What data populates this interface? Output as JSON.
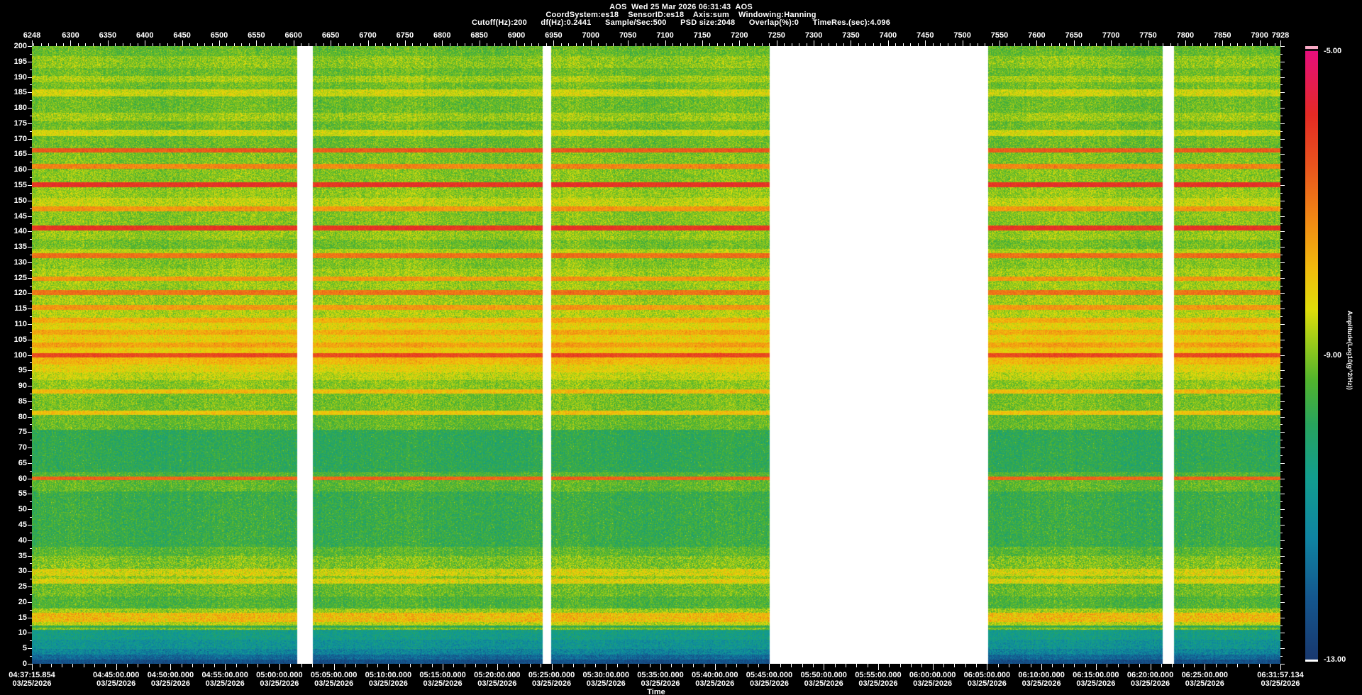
{
  "window": {
    "background": "#000000",
    "text_color": "#ffffff"
  },
  "header": {
    "title_line": "AOS  Wed 25 Mar 2026 06:31:43  AOS",
    "params_line1": "CoordSystem:es18    SensorID:es18    Axis:sum    Windowing:Hanning",
    "params_line2": "Cutoff(Hz):200      df(Hz):0.2441      Sample/Sec:500      PSD size:2048      Overlap(%):0      TimeRes.(sec):4.096"
  },
  "chart_data": {
    "type": "heatmap",
    "subtype": "spectrogram",
    "title": "AOS  Wed 25 Mar 2026 06:31:43  AOS",
    "acquisition": {
      "coord_system": "es18",
      "sensor_id": "es18",
      "axis": "sum",
      "windowing": "Hanning",
      "cutoff_hz": 200,
      "df_hz": 0.2441,
      "sample_per_sec": 500,
      "psd_size": 2048,
      "overlap_pct": 0,
      "time_res_sec": 4.096
    },
    "record_axis": {
      "position": "top",
      "range": [
        6248,
        7928
      ],
      "minor_step": 10,
      "ticks": [
        6248,
        6300,
        6350,
        6400,
        6450,
        6500,
        6550,
        6600,
        6650,
        6700,
        6750,
        6800,
        6850,
        6900,
        6950,
        7000,
        7050,
        7100,
        7150,
        7200,
        7250,
        7300,
        7350,
        7400,
        7450,
        7500,
        7550,
        7600,
        7650,
        7700,
        7750,
        7800,
        7850,
        7900,
        7928
      ]
    },
    "time_axis": {
      "position": "bottom",
      "title": "Time",
      "date": "03/25/2026",
      "start": "04:37:15.854",
      "end": "06:31:57.134",
      "minor_step_sec": 60,
      "ticks": [
        "04:37:15.854",
        "04:45:00.000",
        "04:50:00.000",
        "04:55:00.000",
        "05:00:00.000",
        "05:05:00.000",
        "05:10:00.000",
        "05:15:00.000",
        "05:20:00.000",
        "05:25:00.000",
        "05:30:00.000",
        "05:35:00.000",
        "05:40:00.000",
        "05:45:00.000",
        "05:50:00.000",
        "05:55:00.000",
        "06:00:00.000",
        "06:05:00.000",
        "06:10:00.000",
        "06:15:00.000",
        "06:20:00.000",
        "06:25:00.000",
        "06:31:57.134"
      ]
    },
    "freq_axis": {
      "position": "left",
      "range": [
        0,
        200
      ],
      "minor_step": 2.5,
      "ticks": [
        200,
        195,
        190,
        185,
        180,
        175,
        170,
        165,
        160,
        155,
        150,
        145,
        140,
        135,
        130,
        125,
        120,
        115,
        110,
        105,
        100,
        95,
        90,
        85,
        80,
        75,
        70,
        65,
        60,
        55,
        50,
        45,
        40,
        35,
        30,
        25,
        20,
        15,
        10,
        5,
        0
      ]
    },
    "color_axis": {
      "title": "Amplitude(Log10(g^2/Hz))",
      "lim": [
        -13,
        -5
      ],
      "tick_labels": [
        "-5.00",
        "-9.00",
        "-13.00"
      ],
      "tick_values": [
        -5,
        -9,
        -13
      ],
      "top_clip_color": "#f8a9c4"
    },
    "palette": [
      [
        0.0,
        "#18386e"
      ],
      [
        0.1,
        "#14568e"
      ],
      [
        0.2,
        "#0f84a2"
      ],
      [
        0.3,
        "#129e8e"
      ],
      [
        0.385,
        "#27a45e"
      ],
      [
        0.46,
        "#52b42c"
      ],
      [
        0.52,
        "#9aca1a"
      ],
      [
        0.575,
        "#e0dd0a"
      ],
      [
        0.645,
        "#f2b90d"
      ],
      [
        0.715,
        "#f28d13"
      ],
      [
        0.8,
        "#ea5a1c"
      ],
      [
        0.895,
        "#e42a24"
      ],
      [
        1.0,
        "#e60e7c"
      ]
    ],
    "gaps": [
      {
        "x_frac": [
          0.2125,
          0.225
        ],
        "records": [
          6605,
          6626
        ],
        "time": [
          "05:01:40",
          "05:03:05"
        ]
      },
      {
        "x_frac": [
          0.4091,
          0.4159
        ],
        "records": [
          6935,
          6947
        ],
        "time": [
          "05:24:10",
          "05:24:57"
        ]
      },
      {
        "x_frac": [
          0.5909,
          0.7659
        ],
        "records": [
          7241,
          7535
        ],
        "time": [
          "05:45:00",
          "06:05:08"
        ]
      },
      {
        "x_frac": [
          0.9057,
          0.9148
        ],
        "records": [
          7769,
          7785
        ],
        "time": [
          "06:21:06",
          "06:22:08"
        ]
      }
    ],
    "prominent_lines_hz": [
      166,
      161,
      155,
      147,
      141,
      132,
      125,
      120,
      115,
      111,
      107,
      103,
      100,
      88,
      81,
      60,
      29,
      27,
      15
    ],
    "bands": [
      [
        197,
        200.5,
        -9.25,
        0.5
      ],
      [
        193,
        197,
        -8.95,
        0.55
      ],
      [
        190.5,
        193,
        -9.2,
        0.5
      ],
      [
        188.5,
        190.5,
        -8.8,
        0.5
      ],
      [
        186,
        188.5,
        -9.15,
        0.5
      ],
      [
        183.8,
        186,
        -8.5,
        0.45
      ],
      [
        178.5,
        183.8,
        -9.2,
        0.5
      ],
      [
        175.8,
        178.5,
        -8.85,
        0.5
      ],
      [
        173,
        175.8,
        -9.2,
        0.5
      ],
      [
        171,
        173,
        -8.45,
        0.4
      ],
      [
        167,
        171,
        -9.2,
        0.5
      ],
      [
        165.6,
        167,
        -6.6,
        0.3
      ],
      [
        162,
        165.6,
        -9.05,
        0.5
      ],
      [
        160.4,
        162,
        -7.2,
        0.35
      ],
      [
        156,
        160.4,
        -9.0,
        0.5
      ],
      [
        154.4,
        156,
        -6.0,
        0.25
      ],
      [
        151,
        154.4,
        -8.9,
        0.5
      ],
      [
        148.2,
        151,
        -8.6,
        0.5
      ],
      [
        146.6,
        148.2,
        -7.4,
        0.35
      ],
      [
        142,
        146.6,
        -9.0,
        0.5
      ],
      [
        140.4,
        142,
        -6.05,
        0.25
      ],
      [
        137.5,
        140.4,
        -8.9,
        0.5
      ],
      [
        134.5,
        137.5,
        -9.15,
        0.5
      ],
      [
        133,
        134.5,
        -8.7,
        0.5
      ],
      [
        131.4,
        133,
        -6.9,
        0.3
      ],
      [
        128,
        131.4,
        -9.0,
        0.5
      ],
      [
        125.6,
        128,
        -8.8,
        0.5
      ],
      [
        124.2,
        125.6,
        -7.4,
        0.35
      ],
      [
        121.2,
        124.2,
        -8.85,
        0.5
      ],
      [
        119.6,
        121.2,
        -6.95,
        0.3
      ],
      [
        116.2,
        119.6,
        -8.8,
        0.5
      ],
      [
        114.6,
        116.2,
        -7.45,
        0.35
      ],
      [
        112.2,
        114.6,
        -8.7,
        0.5
      ],
      [
        110.6,
        112.2,
        -7.7,
        0.4
      ],
      [
        108.2,
        110.6,
        -8.3,
        0.5
      ],
      [
        106.6,
        108.2,
        -7.65,
        0.4
      ],
      [
        104.2,
        106.6,
        -8.2,
        0.5
      ],
      [
        102.6,
        104.2,
        -7.55,
        0.4
      ],
      [
        100.6,
        102.6,
        -8.1,
        0.45
      ],
      [
        99.2,
        100.6,
        -6.35,
        0.3
      ],
      [
        97,
        99.2,
        -7.85,
        0.45
      ],
      [
        94.5,
        97,
        -8.3,
        0.5
      ],
      [
        92,
        94.5,
        -8.6,
        0.5
      ],
      [
        89,
        92,
        -8.95,
        0.5
      ],
      [
        87.6,
        89,
        -7.9,
        0.4
      ],
      [
        82,
        87.6,
        -9.1,
        0.5
      ],
      [
        80.6,
        82,
        -8.0,
        0.4
      ],
      [
        76,
        80.6,
        -9.25,
        0.5
      ],
      [
        62,
        76,
        -9.85,
        0.5
      ],
      [
        60.8,
        62,
        -9.4,
        0.45
      ],
      [
        59.6,
        60.8,
        -6.75,
        0.3
      ],
      [
        56,
        59.6,
        -9.3,
        0.5
      ],
      [
        38,
        56,
        -9.7,
        0.55
      ],
      [
        35,
        38,
        -9.35,
        0.55
      ],
      [
        30.8,
        35,
        -9.05,
        0.65
      ],
      [
        28.6,
        30.8,
        -8.4,
        0.6
      ],
      [
        27.6,
        28.6,
        -8.9,
        0.55
      ],
      [
        26,
        27.6,
        -8.35,
        0.6
      ],
      [
        22,
        26,
        -9.2,
        0.55
      ],
      [
        18,
        22,
        -9.45,
        0.5
      ],
      [
        16.6,
        18,
        -8.8,
        0.6
      ],
      [
        13.6,
        16.6,
        -7.9,
        0.75
      ],
      [
        12.6,
        13.6,
        -8.6,
        0.6
      ],
      [
        11.8,
        12.6,
        -9.8,
        0.5
      ],
      [
        11.2,
        11.8,
        -9.1,
        0.5
      ],
      [
        8,
        11.2,
        -10.55,
        0.55
      ],
      [
        5,
        8,
        -10.9,
        0.7
      ],
      [
        3,
        5,
        -11.3,
        0.7
      ],
      [
        1.5,
        3,
        -11.9,
        0.5
      ],
      [
        0,
        1.5,
        -12.4,
        0.35
      ]
    ]
  }
}
